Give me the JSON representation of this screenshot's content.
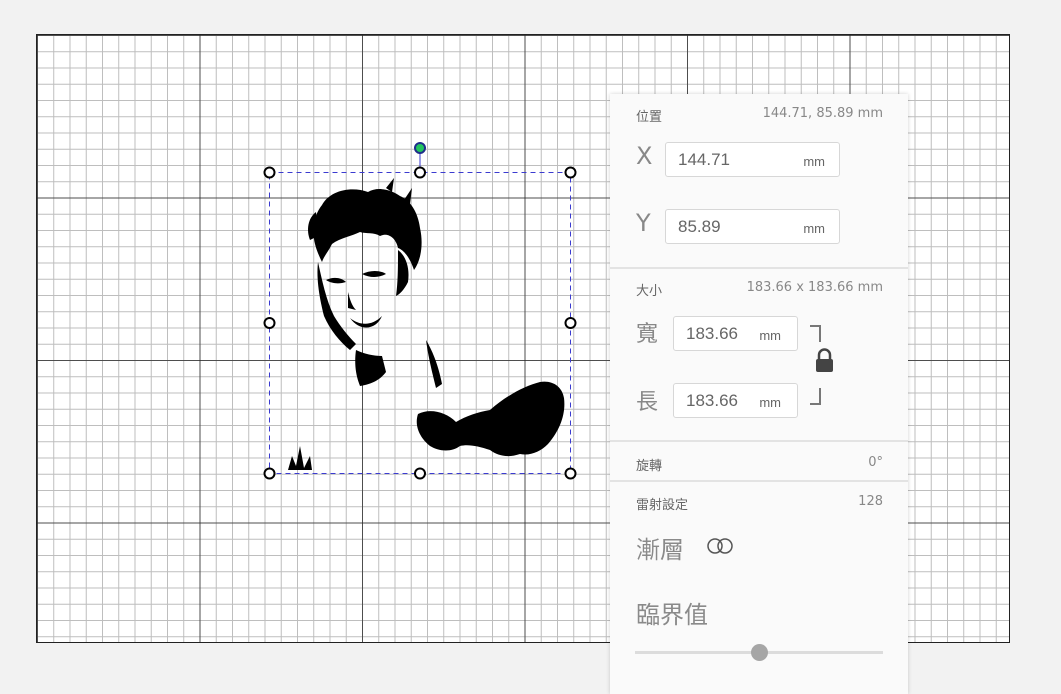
{
  "canvas": {
    "background": "#ffffff",
    "grid_minor_color": "#bdbdbd",
    "grid_major_color": "#333333"
  },
  "selection": {
    "box_color": "#3b3bd0",
    "rotate_handle_color": "#22c55e"
  },
  "panel": {
    "position": {
      "label": "位置",
      "summary": "144.71, 85.89 mm",
      "x_label": "X",
      "x_value": "144.71",
      "x_unit": "mm",
      "y_label": "Y",
      "y_value": "85.89",
      "y_unit": "mm"
    },
    "size": {
      "label": "大小",
      "summary": "183.66 x 183.66 mm",
      "width_label": "寬",
      "width_value": "183.66",
      "width_unit": "mm",
      "height_label": "長",
      "height_value": "183.66",
      "height_unit": "mm",
      "lock_icon": "lock-icon"
    },
    "rotation": {
      "label": "旋轉",
      "value": "0°"
    },
    "laser": {
      "label": "雷射設定",
      "value": "128",
      "gradient_label": "漸層",
      "gradient_toggle_icon": "toggle-icon",
      "threshold_label": "臨界值",
      "threshold_level": 0.5,
      "threshold_max": 255
    }
  }
}
